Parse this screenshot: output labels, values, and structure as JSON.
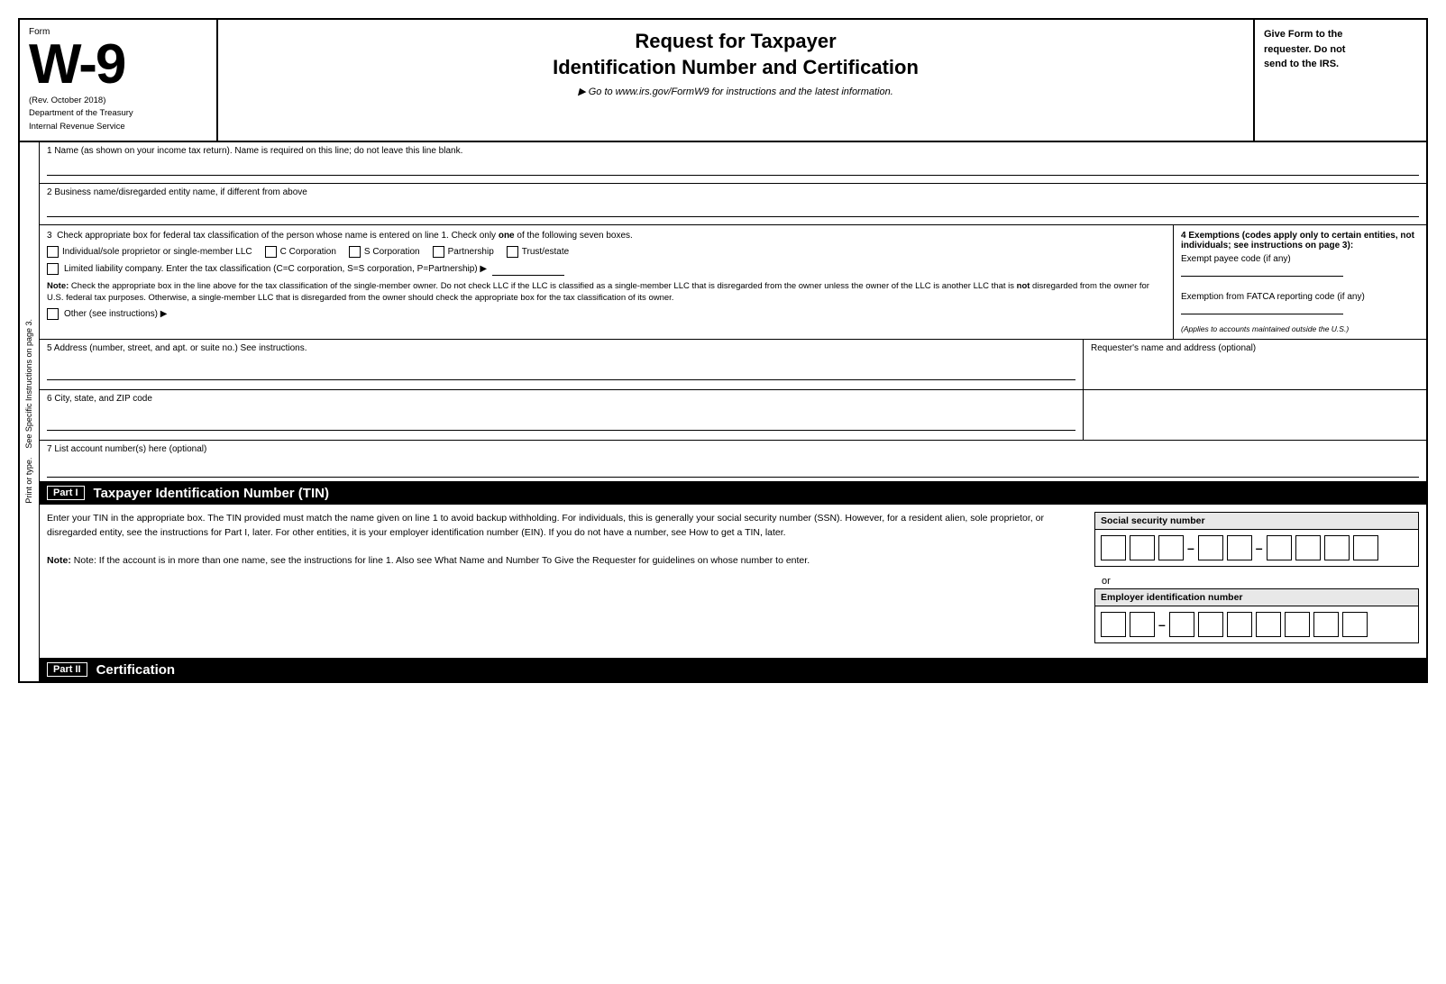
{
  "header": {
    "form_label": "Form",
    "form_number": "W-9",
    "form_subtitle": "(Rev. October 2018)",
    "dept_line1": "Department of the Treasury",
    "dept_line2": "Internal Revenue Service",
    "title_line1": "Request for Taxpayer",
    "title_line2": "Identification Number and Certification",
    "goto_text": "▶ Go to www.irs.gov/FormW9 for instructions and the latest information.",
    "right_text_line1": "Give Form to the",
    "right_text_line2": "requester. Do not",
    "right_text_line3": "send to the IRS."
  },
  "fields": {
    "field1_label": "1  Name (as shown on your income tax return). Name is required on this line; do not leave this line blank.",
    "field2_label": "2  Business name/disregarded entity name, if different from above",
    "field3_label": "3  Check appropriate box for federal tax classification of the person whose name is entered on line 1. Check only",
    "field3_label_bold": "one",
    "field3_label_end": "of the following seven boxes.",
    "checkbox1_label": "Individual/sole proprietor or single-member LLC",
    "checkbox2_label": "C Corporation",
    "checkbox3_label": "S Corporation",
    "checkbox4_label": "Partnership",
    "checkbox5_label": "Trust/estate",
    "llc_label": "Limited liability company. Enter the tax classification (C=C corporation, S=S corporation, P=Partnership) ▶",
    "note_label": "Note:",
    "note_text": "Check the appropriate box in the line above for the tax classification of the single-member owner. Do not check LLC if the LLC is classified as a single-member LLC that is disregarded from the owner unless the owner of the LLC is another LLC that is",
    "note_not": "not",
    "note_text2": "disregarded from the owner for U.S. federal tax purposes. Otherwise, a single-member LLC that is disregarded from the owner should check the appropriate box for the tax classification of its owner.",
    "other_label": "Other (see instructions) ▶",
    "field4_header": "4  Exemptions (codes apply only to certain entities, not individuals; see instructions on page 3):",
    "exempt_payee_label": "Exempt payee code (if any)",
    "fatca_label": "Exemption from FATCA reporting code (if any)",
    "fatca_note": "(Applies to accounts maintained outside the U.S.)",
    "field5_label": "5  Address (number, street, and apt. or suite no.) See instructions.",
    "requester_label": "Requester's name and address (optional)",
    "field6_label": "6  City, state, and ZIP code",
    "field7_label": "7  List account number(s) here (optional)",
    "side_label_line1": "Print or type.",
    "side_label_line2": "See Specific Instructions on page 3."
  },
  "part1": {
    "tag": "Part I",
    "title": "Taxpayer Identification Number (TIN)",
    "body_text": "Enter your TIN in the appropriate box. The TIN provided must match the name given on line 1 to avoid backup withholding. For individuals, this is generally your social security number (SSN). However, for a resident alien, sole proprietor, or disregarded entity, see the instructions for Part I, later. For other entities, it is your employer identification number (EIN). If you do not have a number, see How to get a TIN, later.",
    "note_text": "Note: If the account is in more than one name, see the instructions for line 1. Also see What Name and Number To Give the Requester for guidelines on whose number to enter.",
    "ssn_label": "Social security number",
    "ein_label": "Employer identification number",
    "or_text": "or"
  },
  "part2": {
    "tag": "Part II",
    "title": "Certification"
  }
}
